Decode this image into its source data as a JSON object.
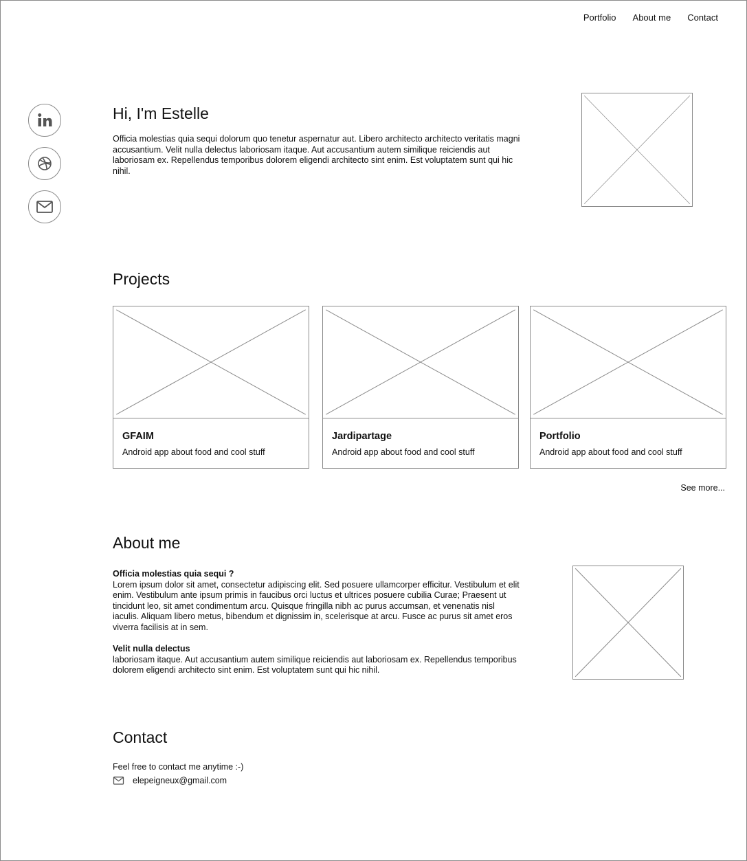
{
  "nav": {
    "items": [
      "Portfolio",
      "About me",
      "Contact"
    ]
  },
  "social": {
    "icons": [
      "linkedin-icon",
      "dribbble-icon",
      "mail-icon"
    ]
  },
  "hero": {
    "title": "Hi, I'm Estelle",
    "text": "Officia molestias quia sequi dolorum quo tenetur aspernatur aut. Libero architecto architecto veritatis magni accusantium. Velit nulla delectus laboriosam itaque. Aut accusantium autem similique reiciendis aut laboriosam ex. Repellendus temporibus dolorem eligendi architecto sint enim. Est voluptatem sunt qui hic nihil."
  },
  "projects": {
    "title": "Projects",
    "cards": [
      {
        "title": "GFAIM",
        "desc": "Android app about food and cool stuff"
      },
      {
        "title": "Jardipartage",
        "desc": "Android app about food and cool stuff"
      },
      {
        "title": "Portfolio",
        "desc": "Android app about food and cool stuff"
      }
    ],
    "see_more": "See more..."
  },
  "about": {
    "title": "About me",
    "blocks": [
      {
        "heading": "Officia molestias quia sequi ?",
        "text": "Lorem ipsum dolor sit amet, consectetur adipiscing elit. Sed posuere ullamcorper efficitur. Vestibulum et elit enim. Vestibulum ante ipsum primis in faucibus orci luctus et ultrices posuere cubilia Curae; Praesent ut tincidunt leo, sit amet condimentum arcu. Quisque fringilla nibh ac purus accumsan, et venenatis nisl iaculis. Aliquam libero metus, bibendum et dignissim in, scelerisque at arcu. Fusce ac purus sit amet eros viverra facilisis at in sem."
      },
      {
        "heading": "Velit nulla delectus",
        "text": "laboriosam itaque. Aut accusantium autem similique reiciendis aut laboriosam ex. Repellendus temporibus dolorem eligendi architecto sint enim. Est voluptatem sunt qui hic nihil."
      }
    ]
  },
  "contact": {
    "title": "Contact",
    "text": "Feel free to contact me anytime :-)",
    "email": "elepeigneux@gmail.com"
  },
  "colors": {
    "stroke": "#8a8a8a",
    "text": "#111111",
    "background": "#ffffff"
  }
}
